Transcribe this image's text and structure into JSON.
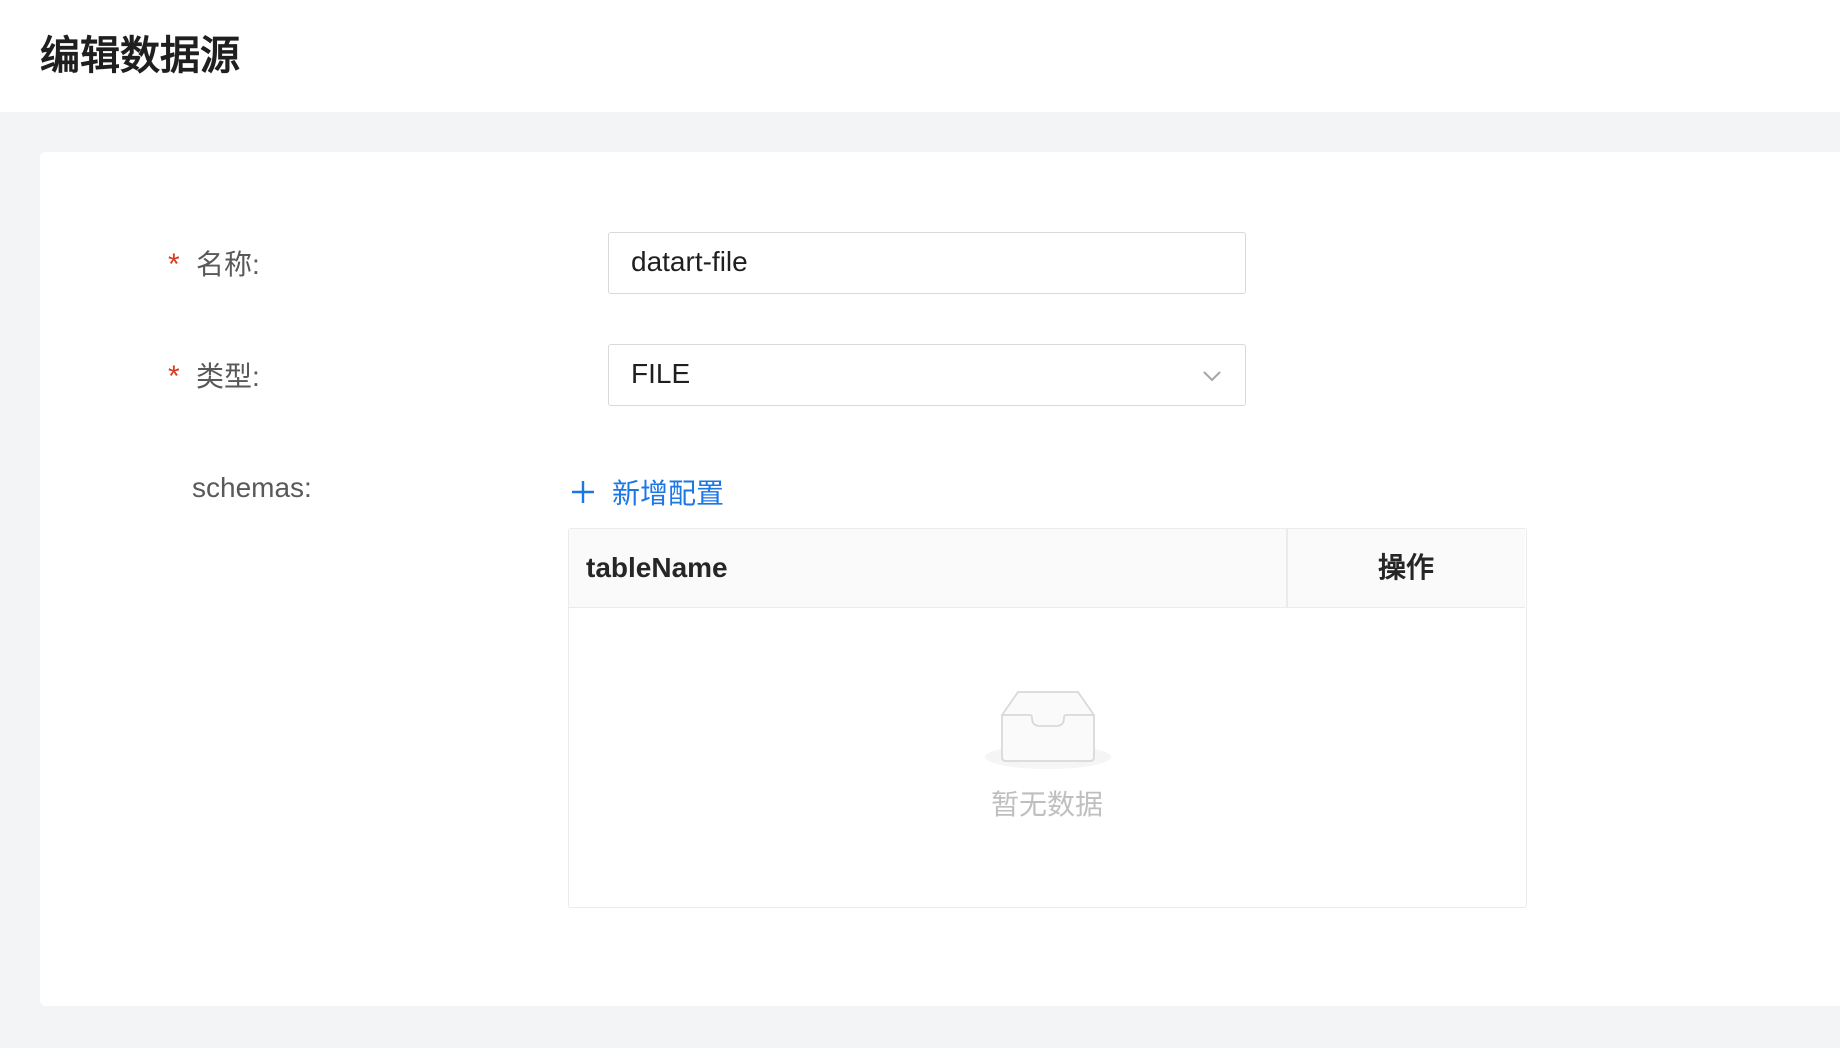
{
  "header": {
    "title": "编辑数据源"
  },
  "form": {
    "name": {
      "required_mark": "*",
      "label": "名称:",
      "value": "datart-file"
    },
    "type": {
      "required_mark": "*",
      "label": "类型:",
      "selected": "FILE"
    },
    "schemas": {
      "label": "schemas:",
      "add_button_label": "新增配置",
      "table": {
        "columns": [
          "tableName",
          "操作"
        ],
        "rows": [],
        "empty_text": "暂无数据"
      }
    }
  },
  "colors": {
    "accent": "#1b76e6",
    "required": "#d93a1e",
    "page_bg": "#f3f4f6"
  }
}
